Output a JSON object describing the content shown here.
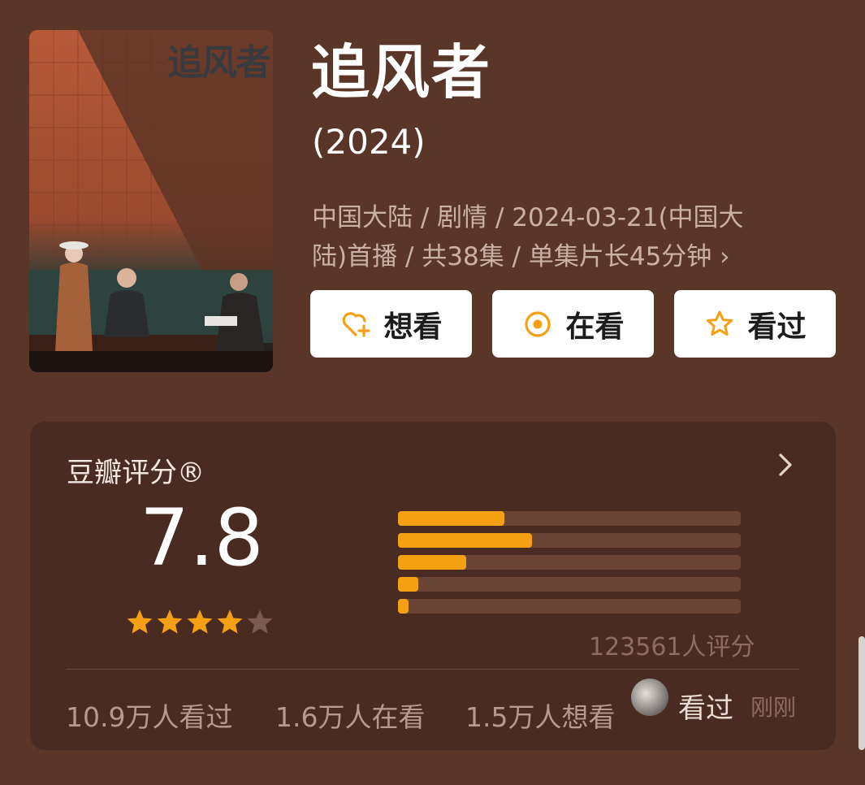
{
  "poster": {
    "title": "追风者"
  },
  "movie": {
    "title": "追风者",
    "year": "(2024)",
    "meta_line1": "中国大陆 / 剧情 / 2024-03-21(中国大",
    "meta_line2": "陆)首播 / 共38集 / 单集片长45分钟",
    "meta_chevron": "›"
  },
  "actions": {
    "want": "想看",
    "watching": "在看",
    "watched": "看过"
  },
  "rating": {
    "header": "豆瓣评分®",
    "score": "7.8",
    "stars_filled": 4,
    "stars_total": 5,
    "distribution": [
      {
        "stars": 5,
        "fraction": 0.31
      },
      {
        "stars": 4,
        "fraction": 0.39
      },
      {
        "stars": 3,
        "fraction": 0.2
      },
      {
        "stars": 2,
        "fraction": 0.06
      },
      {
        "stars": 1,
        "fraction": 0.03
      }
    ],
    "count_text": "123561人评分"
  },
  "footer": {
    "watched_count": "10.9万人看过",
    "watching_count": "1.6万人在看",
    "want_count": "1.5万人想看",
    "activity_label": "看过",
    "activity_time": "刚刚"
  },
  "colors": {
    "background": "#5a3629",
    "card": "#4a2b21",
    "accent": "#f4a012",
    "track": "#6a4435"
  },
  "icons": {
    "want": "heart-plus-icon",
    "watching": "target-dot-icon",
    "watched": "star-outline-icon"
  }
}
